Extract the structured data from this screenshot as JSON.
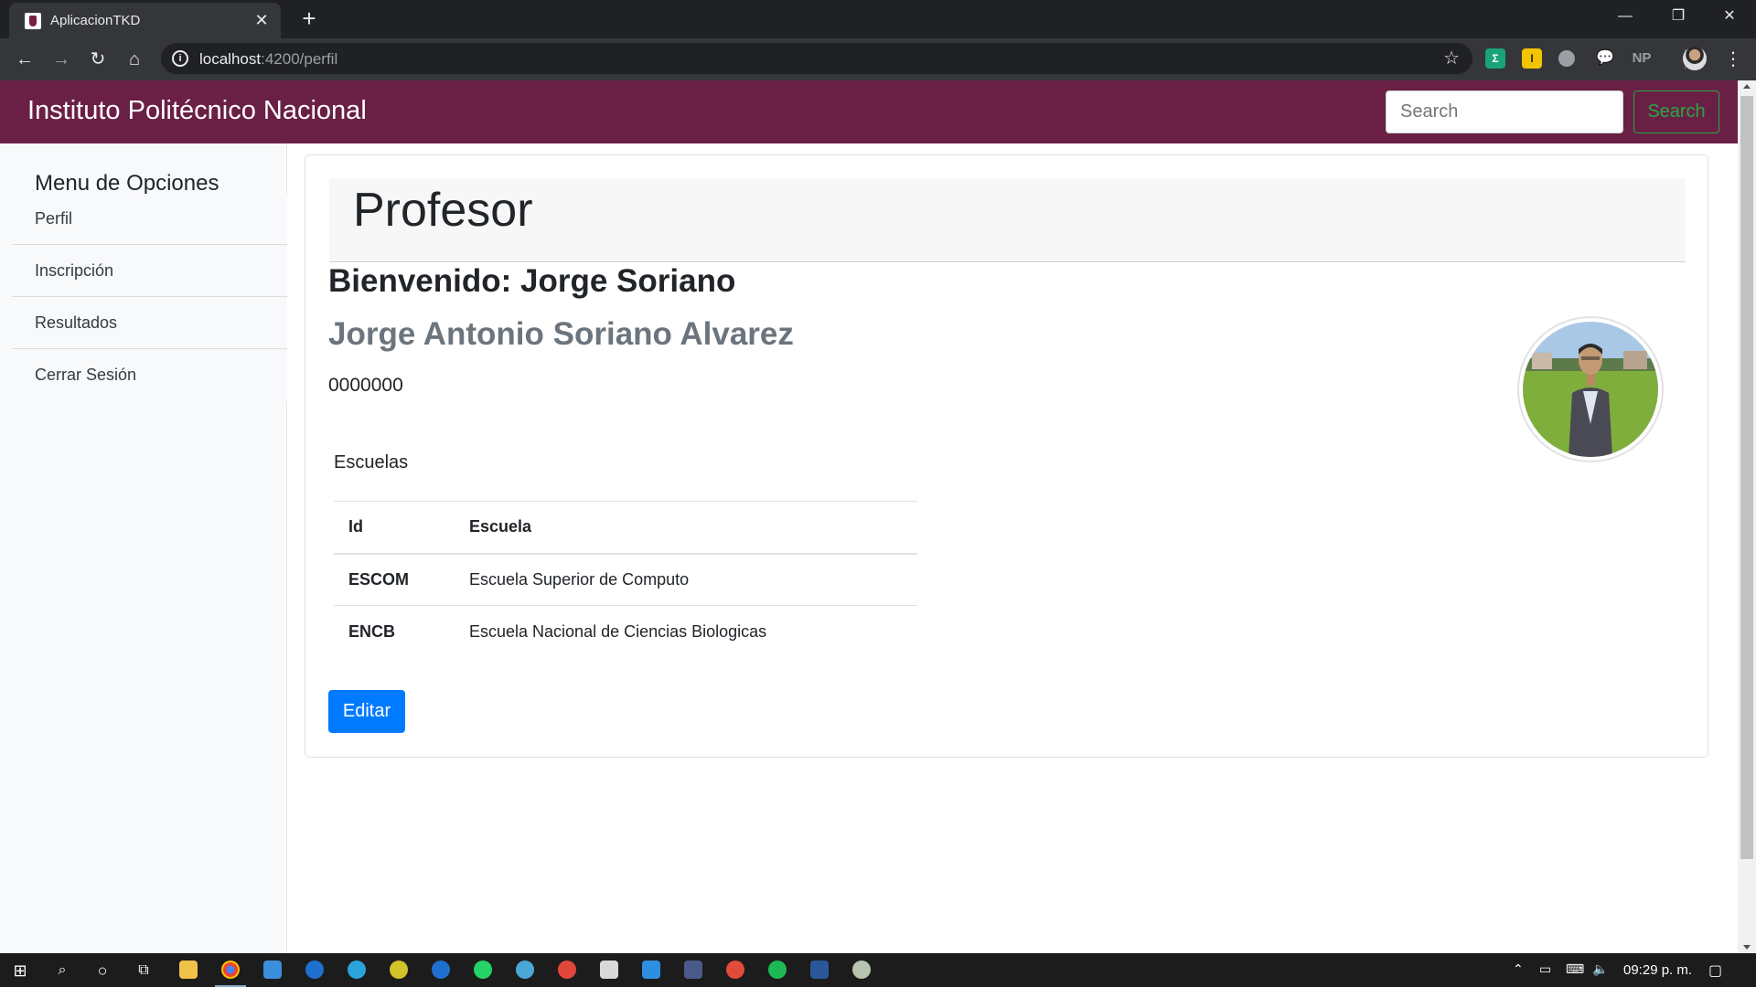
{
  "browser": {
    "tab_title": "AplicacionTKD",
    "url_host": "localhost",
    "url_rest": ":4200/perfil",
    "window_controls": [
      "—",
      "❐",
      "✕"
    ],
    "extension_np": "NP"
  },
  "navbar": {
    "brand": "Instituto Politécnico Nacional",
    "search_placeholder": "Search",
    "search_button": "Search"
  },
  "sidebar": {
    "title": "Menu de Opciones",
    "items": [
      {
        "label": "Perfil"
      },
      {
        "label": "Inscripción"
      },
      {
        "label": "Resultados"
      },
      {
        "label": "Cerrar Sesión"
      }
    ]
  },
  "main": {
    "heading": "Profesor",
    "welcome": "Bienvenido: Jorge Soriano",
    "full_name": "Jorge Antonio Soriano Alvarez",
    "id_number": "0000000",
    "table_caption": "Escuelas",
    "table_headers": [
      "Id",
      "Escuela"
    ],
    "rows": [
      {
        "id": "ESCOM",
        "escuela": "Escuela Superior de Computo"
      },
      {
        "id": "ENCB",
        "escuela": "Escuela Nacional de Ciencias Biologicas"
      }
    ],
    "edit_button": "Editar"
  },
  "taskbar": {
    "clock": "09:29 p. m."
  },
  "colors": {
    "navbar": "#6a2045",
    "success": "#28a745",
    "primary": "#007bff",
    "muted": "#6c757d"
  }
}
